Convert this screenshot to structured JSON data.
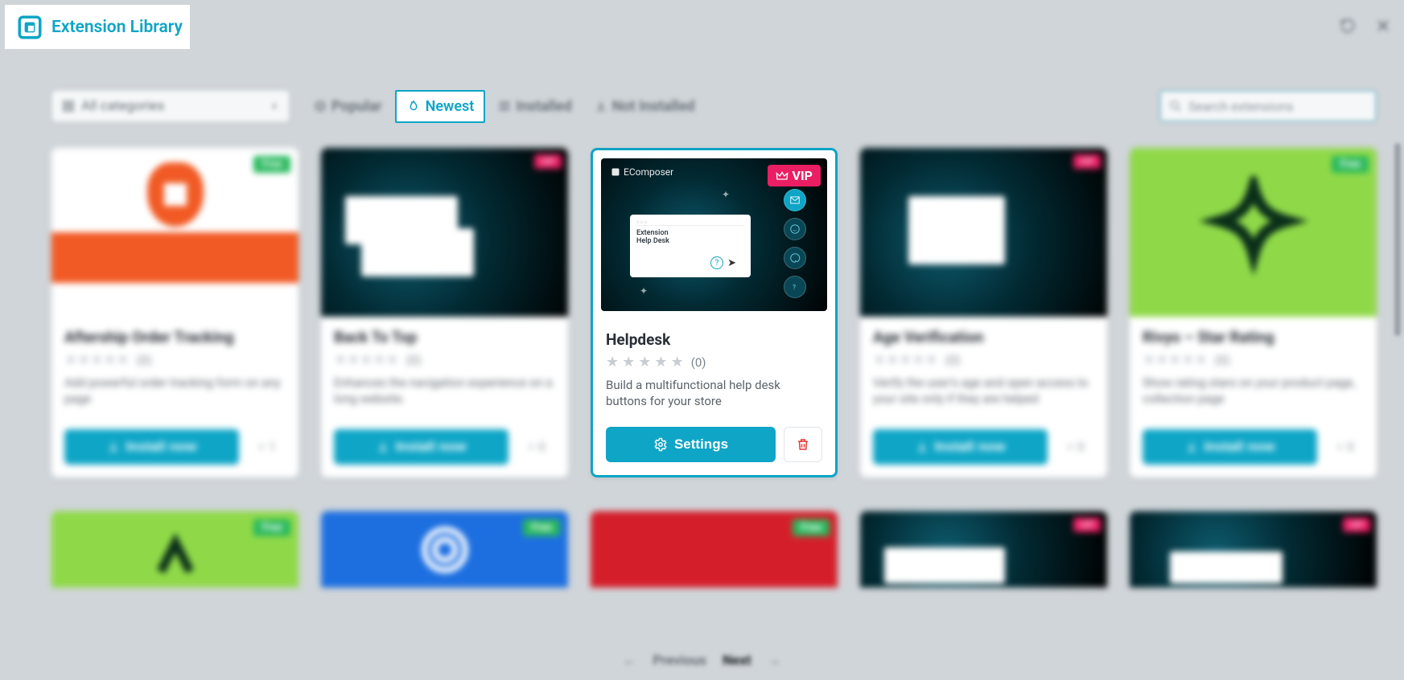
{
  "header": {
    "title": "Extension Library"
  },
  "filters": {
    "category_label": "All categories",
    "tabs": {
      "popular": "Popular",
      "newest": "Newest",
      "installed": "Installed",
      "not_installed": "Not Installed"
    },
    "search_placeholder": "Search extensions"
  },
  "badges": {
    "free": "Free",
    "vip": "VIP"
  },
  "cards_row1": [
    {
      "title": "Aftership Order Tracking",
      "rating_count": "(0)",
      "desc": "Add powerful order tracking form on any page",
      "action": "Install now",
      "downloads": "1",
      "badge": "free"
    },
    {
      "title": "Back To Top",
      "rating_count": "(0)",
      "desc": "Enhances the navigation experience on a long website.",
      "action": "Install now",
      "downloads": "0",
      "badge": "vip"
    },
    {
      "title": "Helpdesk",
      "rating_count": "(0)",
      "desc": "Build a multifunctional help desk buttons for your store",
      "action": "Settings",
      "badge": "vip",
      "thumb": {
        "brand": "EComposer",
        "mini_line1": "Extension",
        "mini_line2": "Help Desk"
      }
    },
    {
      "title": "Age Verification",
      "rating_count": "(0)",
      "desc": "Verify the user's age and open access to your site only if they are helped",
      "action": "Install now",
      "downloads": "0",
      "badge": "vip"
    },
    {
      "title": "Rivyo – Star Rating",
      "rating_count": "(0)",
      "desc": "Show rating stars on your product page, collection page",
      "action": "Install now",
      "downloads": "0",
      "badge": "free"
    }
  ],
  "cards_row2_badges": [
    "free",
    "free",
    "free",
    "vip",
    "vip"
  ],
  "pagination": {
    "prev": "Previous",
    "next": "Next"
  },
  "colors": {
    "accent": "#0ea5c6",
    "vip": "#e91e63",
    "free": "#27b85c"
  }
}
